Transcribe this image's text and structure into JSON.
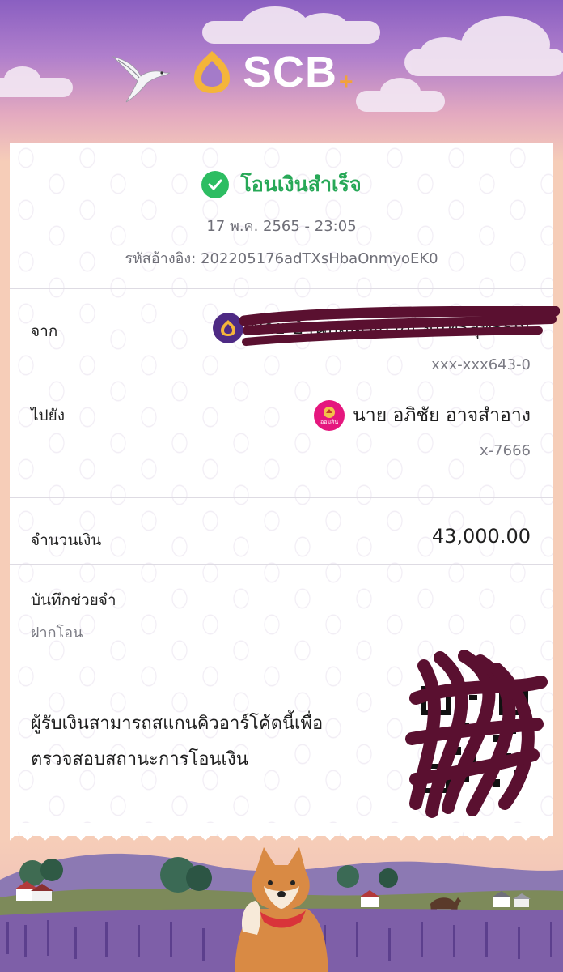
{
  "brand": {
    "name": "SCB",
    "plus": "+"
  },
  "status": {
    "text": "โอนเงินสำเร็จ"
  },
  "datetime": "17 พ.ค. 2565 - 23:05",
  "reference": "รหัสอ้างอิง: 202205176adTXsHbaOnmyoEK0",
  "from": {
    "label": "จาก",
    "name": "นาย บ้านบุญสุขกรณ์ จันทร์สุทธิรณ์",
    "account": "xxx-xxx643-0"
  },
  "to": {
    "label": "ไปยัง",
    "name": "นาย อภิชัย อาจสำอาง",
    "account": "x-7666",
    "bank_badge": "ออมสิน"
  },
  "amount": {
    "label": "จำนวนเงิน",
    "value": "43,000.00"
  },
  "memo": {
    "label": "บันทึกช่วยจำ",
    "value": "ฝากโอน"
  },
  "qr_note": {
    "line1": "ผู้รับเงินสามารถสแกนคิวอาร์โค้ดนี้เพื่อ",
    "line2": "ตรวจสอบสถานะการโอนเงิน"
  },
  "colors": {
    "success": "#27a857",
    "scb_purple": "#4e2a84",
    "gsb_pink": "#e5177e",
    "redaction": "#5a1030"
  },
  "icons": [
    "bird-icon",
    "scb-logo-icon",
    "check-circle-icon",
    "scb-avatar-icon",
    "gsb-avatar-icon",
    "qr-code-icon",
    "shiba-dog-illustration"
  ]
}
